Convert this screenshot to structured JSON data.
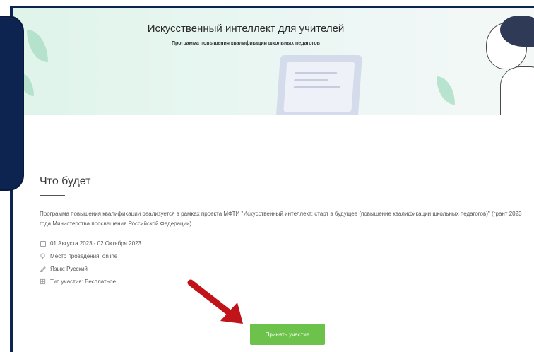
{
  "banner": {
    "title": "Искусственный интеллект для учителей",
    "subtitle": "Программа повышения квалификации школьных педагогов"
  },
  "section": {
    "title": "Что будет",
    "description": "Программа повышения квалификации реализуется в рамках проекта МФТИ \"Искусственный интеллект: старт в будущее (повышение квалификации школьных педагогов)\" (грант 2023 года Министерства просвещения Российской Федерации)"
  },
  "details": {
    "dates": "01 Августа 2023 - 02 Октября 2023",
    "location": "Место проведения: online",
    "language": "Язык: Русский",
    "participation": "Тип участия: Бесплатное"
  },
  "icons": {
    "dates": "calendar-icon",
    "location": "location-pin-icon",
    "language": "pen-icon",
    "participation": "ticket-icon"
  },
  "actions": {
    "join_label": "Принять участие"
  },
  "colors": {
    "frame": "#0d2350",
    "button": "#6cc24a",
    "arrow": "#c0131a"
  }
}
